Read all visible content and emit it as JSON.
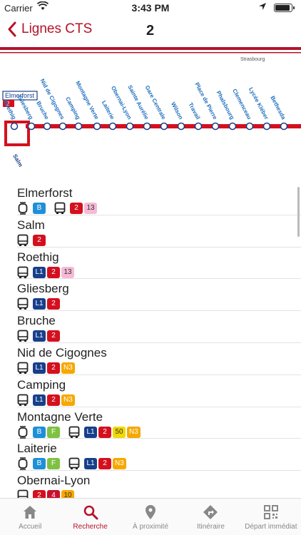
{
  "status": {
    "carrier": "Carrier",
    "time": "3:43 PM"
  },
  "nav": {
    "back_label": "Lignes CTS",
    "title": "2"
  },
  "map": {
    "city_label": "Strasbourg",
    "terminus_label": "Elmerforst",
    "terminus_line": "2",
    "stations": [
      "Roethig",
      "Gliesberg",
      "Bruche",
      "Nid de Cigognes",
      "Camping",
      "Montagne Verte",
      "Laiterie",
      "Obernai-Lyon",
      "Sainte Aurélie",
      "Gare Centrale",
      "Wilson",
      "Travail",
      "Place de Pierre",
      "Phalsbourg",
      "Clemenceau",
      "Lycée Kléber",
      "Bethesda"
    ],
    "branch_label": "Salm",
    "line_color": "#d4101f"
  },
  "stops": [
    {
      "name": "Elmerforst",
      "groups": [
        {
          "mode": "tram",
          "lines": [
            {
              "l": "B",
              "c": "#1f8fd8",
              "t": "#fff"
            }
          ]
        },
        {
          "mode": "bus",
          "lines": [
            {
              "l": "2",
              "c": "#d4101f",
              "t": "#fff"
            },
            {
              "l": "13",
              "c": "#f6b9d6",
              "t": "#333"
            }
          ]
        }
      ]
    },
    {
      "name": "Salm",
      "groups": [
        {
          "mode": "bus",
          "lines": [
            {
              "l": "2",
              "c": "#d4101f",
              "t": "#fff"
            }
          ]
        }
      ]
    },
    {
      "name": "Roethig",
      "groups": [
        {
          "mode": "bus",
          "lines": [
            {
              "l": "L1",
              "c": "#173f8a",
              "t": "#fff"
            },
            {
              "l": "2",
              "c": "#d4101f",
              "t": "#fff"
            },
            {
              "l": "13",
              "c": "#f6b9d6",
              "t": "#333"
            }
          ]
        }
      ]
    },
    {
      "name": "Gliesberg",
      "groups": [
        {
          "mode": "bus",
          "lines": [
            {
              "l": "L1",
              "c": "#173f8a",
              "t": "#fff"
            },
            {
              "l": "2",
              "c": "#d4101f",
              "t": "#fff"
            }
          ]
        }
      ]
    },
    {
      "name": "Bruche",
      "groups": [
        {
          "mode": "bus",
          "lines": [
            {
              "l": "L1",
              "c": "#173f8a",
              "t": "#fff"
            },
            {
              "l": "2",
              "c": "#d4101f",
              "t": "#fff"
            }
          ]
        }
      ]
    },
    {
      "name": "Nid de Cigognes",
      "groups": [
        {
          "mode": "bus",
          "lines": [
            {
              "l": "L1",
              "c": "#173f8a",
              "t": "#fff"
            },
            {
              "l": "2",
              "c": "#d4101f",
              "t": "#fff"
            },
            {
              "l": "N3",
              "c": "#f6a800",
              "t": "#fff"
            }
          ]
        }
      ]
    },
    {
      "name": "Camping",
      "groups": [
        {
          "mode": "bus",
          "lines": [
            {
              "l": "L1",
              "c": "#173f8a",
              "t": "#fff"
            },
            {
              "l": "2",
              "c": "#d4101f",
              "t": "#fff"
            },
            {
              "l": "N3",
              "c": "#f6a800",
              "t": "#fff"
            }
          ]
        }
      ]
    },
    {
      "name": "Montagne Verte",
      "groups": [
        {
          "mode": "tram",
          "lines": [
            {
              "l": "B",
              "c": "#1f8fd8",
              "t": "#fff"
            },
            {
              "l": "F",
              "c": "#7fc243",
              "t": "#fff"
            }
          ]
        },
        {
          "mode": "bus",
          "lines": [
            {
              "l": "L1",
              "c": "#173f8a",
              "t": "#fff"
            },
            {
              "l": "2",
              "c": "#d4101f",
              "t": "#fff"
            },
            {
              "l": "50",
              "c": "#f2d900",
              "t": "#333"
            },
            {
              "l": "N3",
              "c": "#f6a800",
              "t": "#fff"
            }
          ]
        }
      ]
    },
    {
      "name": "Laiterie",
      "groups": [
        {
          "mode": "tram",
          "lines": [
            {
              "l": "B",
              "c": "#1f8fd8",
              "t": "#fff"
            },
            {
              "l": "F",
              "c": "#7fc243",
              "t": "#fff"
            }
          ]
        },
        {
          "mode": "bus",
          "lines": [
            {
              "l": "L1",
              "c": "#173f8a",
              "t": "#fff"
            },
            {
              "l": "2",
              "c": "#d4101f",
              "t": "#fff"
            },
            {
              "l": "N3",
              "c": "#f6a800",
              "t": "#fff"
            }
          ]
        }
      ]
    },
    {
      "name": "Obernai-Lyon",
      "groups": [
        {
          "mode": "bus",
          "lines": [
            {
              "l": "2",
              "c": "#d4101f",
              "t": "#fff"
            },
            {
              "l": "4",
              "c": "#c8102e",
              "t": "#fff"
            },
            {
              "l": "10",
              "c": "#f6a800",
              "t": "#333"
            }
          ]
        }
      ]
    }
  ],
  "tabs": [
    {
      "label": "Accueil",
      "icon": "home-icon"
    },
    {
      "label": "Recherche",
      "icon": "search-icon"
    },
    {
      "label": "À proximité",
      "icon": "location-pin-icon"
    },
    {
      "label": "Itinéraire",
      "icon": "route-icon"
    },
    {
      "label": "Départ immédiat",
      "icon": "qr-code-icon"
    }
  ]
}
